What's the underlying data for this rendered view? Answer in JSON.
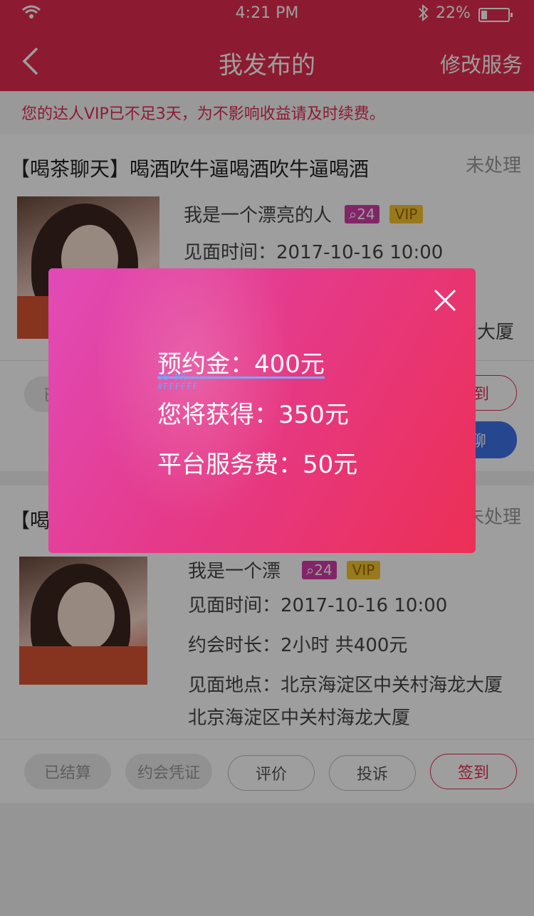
{
  "status_bar": {
    "time": "4:21 PM",
    "battery_pct": "22%",
    "battery_level": 0.22
  },
  "nav": {
    "back_icon": "chevron-left-icon",
    "title": "我发布的",
    "right_action": "修改服务"
  },
  "notice": "您的达人VIP已不足3天，为不影响收益请及时续费。",
  "orders": [
    {
      "title": "【喝茶聊天】喝酒吹牛逼喝酒吹牛逼喝酒",
      "status": "未处理",
      "name": "我是一个漂亮的人",
      "chat_count": "24",
      "vip": "VIP",
      "meet_time": "见面时间：2017-10-16  10:00",
      "address_tail": "大厦",
      "actions": {
        "settled": "已结算",
        "checkin": "签到",
        "chat": "a聊"
      }
    },
    {
      "title": "【喝茶聊天】",
      "status": "未处理",
      "name": "我是一个漂",
      "chat_count": "24",
      "vip": "VIP",
      "meet_time": "见面时间：2017-10-16  10:00",
      "duration": "约会时长：2小时  共400元",
      "location": "见面地点：北京海淀区中关村海龙大厦",
      "location2": "北京海淀区中关村海龙大厦",
      "actions": {
        "settled": "已结算",
        "voucher": "约会凭证",
        "review": "评价",
        "complain": "投诉",
        "checkin": "签到"
      }
    }
  ],
  "modal": {
    "deposit_label": "预约金",
    "deposit_value": "：400元",
    "annotation_size": "36 PX",
    "annotation_color": "#FFFFFF",
    "earn": "您将获得：350元",
    "fee": "平台服务费：50元",
    "close_icon": "close-icon"
  },
  "colors": {
    "brand": "#e32d4f",
    "chat_badge": "#d23da8",
    "vip_badge": "#f6c52e",
    "chat_button": "#3f72e8"
  }
}
